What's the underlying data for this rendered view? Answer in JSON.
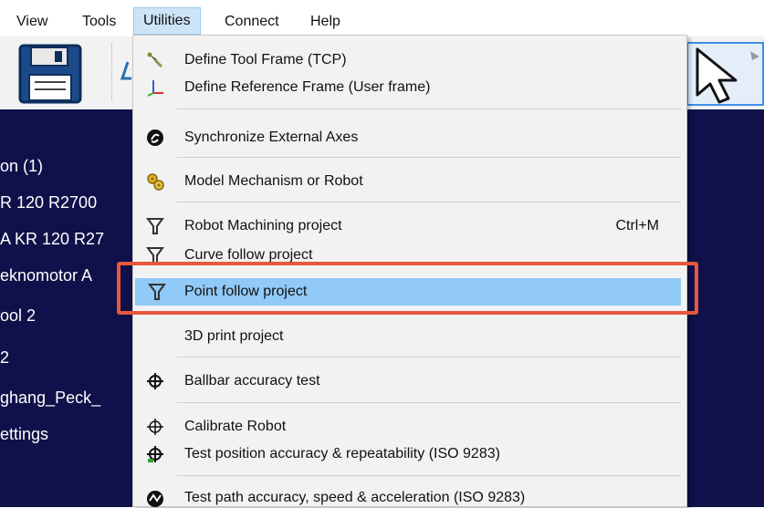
{
  "menubar": {
    "items": [
      {
        "label": "View"
      },
      {
        "label": "Tools"
      },
      {
        "label": "Utilities"
      },
      {
        "label": "Connect"
      },
      {
        "label": "Help"
      }
    ]
  },
  "tree": {
    "items": [
      {
        "label": "on (1)"
      },
      {
        "label": "R 120 R2700"
      },
      {
        "label": "A KR 120 R27"
      },
      {
        "label": "eknomotor A"
      },
      {
        "label": "ool 2"
      },
      {
        "label": "2"
      },
      {
        "label": "ghang_Peck_"
      },
      {
        "label": "ettings"
      }
    ]
  },
  "utilities_menu": {
    "items": [
      {
        "label": "Define Tool Frame (TCP)",
        "icon": "tool-frame-icon"
      },
      {
        "label": "Define Reference Frame (User frame)",
        "icon": "reference-frame-icon"
      },
      {
        "label": "Synchronize External Axes",
        "icon": "sync-axes-icon"
      },
      {
        "label": "Model Mechanism or Robot",
        "icon": "gears-icon"
      },
      {
        "label": "Robot Machining project",
        "icon": "machining-icon",
        "shortcut": "Ctrl+M"
      },
      {
        "label": "Curve follow project",
        "icon": "curve-follow-icon"
      },
      {
        "label": "Point follow project",
        "icon": "point-follow-icon"
      },
      {
        "label": "3D print project",
        "icon": ""
      },
      {
        "label": "Ballbar accuracy test",
        "icon": "crosshair-icon"
      },
      {
        "label": "Calibrate Robot",
        "icon": "crosshair-icon"
      },
      {
        "label": "Test position accuracy & repeatability (ISO 9283)",
        "icon": "crosshair-icon"
      },
      {
        "label": "Test path accuracy, speed & acceleration (ISO 9283)",
        "icon": "path-test-icon"
      }
    ]
  },
  "colors": {
    "tree_bg": "#10104a",
    "highlight": "#91c9f7",
    "callout": "#e8583c"
  }
}
